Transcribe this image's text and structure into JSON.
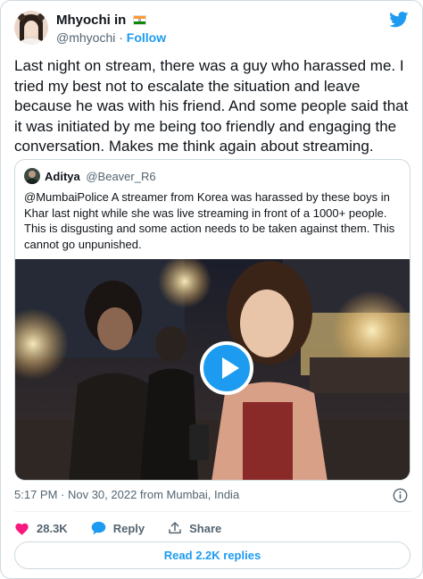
{
  "author": {
    "name": "Mhyochi in",
    "handle": "@mhyochi",
    "separator": "·",
    "follow_label": "Follow"
  },
  "tweet": {
    "text": "Last night on stream, there was a guy who harassed me. I tried my best not to escalate the situation and leave because he was with his friend. And some people said that it was initiated by me being too friendly and engaging the conversation. Makes me think again about streaming."
  },
  "quoted": {
    "name": "Aditya",
    "handle": "@Beaver_R6",
    "text": "@MumbaiPolice A streamer from Korea was harassed by these boys in Khar last night while she was live streaming in front of a 1000+ people. This is disgusting and some action needs to be taken against them. This cannot go unpunished."
  },
  "meta": {
    "timestamp": "5:17 PM · Nov 30, 2022 from Mumbai, India"
  },
  "actions": {
    "likes": "28.3K",
    "reply_label": "Reply",
    "share_label": "Share"
  },
  "read_replies_label": "Read 2.2K replies",
  "icons": {
    "brand": "twitter-bird-icon",
    "like": "heart-icon",
    "reply": "speech-bubble-icon",
    "share": "share-icon",
    "info": "info-icon",
    "play": "play-icon",
    "flag": "india-flag-icon"
  },
  "colors": {
    "accent": "#1d9bf0",
    "like": "#f91880",
    "text": "#0f1419",
    "secondary": "#536471",
    "border": "#cfd9de"
  }
}
